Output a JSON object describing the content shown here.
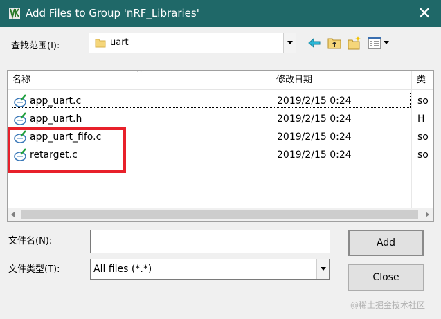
{
  "window": {
    "title": "Add Files to Group 'nRF_Libraries'",
    "close_glyph": "✕"
  },
  "toolbar": {
    "look_in_label": "查找范围(I):",
    "look_in_value": "uart",
    "buttons": [
      {
        "name": "back-icon"
      },
      {
        "name": "up-folder-icon"
      },
      {
        "name": "new-folder-icon"
      },
      {
        "name": "view-menu-icon"
      }
    ]
  },
  "file_list": {
    "columns": [
      "名称",
      "修改日期",
      "类"
    ],
    "sort_indicator": "^",
    "rows": [
      {
        "name": "app_uart.c",
        "date": "2019/2/15 0:24",
        "type": "so"
      },
      {
        "name": "app_uart.h",
        "date": "2019/2/15 0:24",
        "type": "H"
      },
      {
        "name": "app_uart_fifo.c",
        "date": "2019/2/15 0:24",
        "type": "so"
      },
      {
        "name": "retarget.c",
        "date": "2019/2/15 0:24",
        "type": "so"
      }
    ]
  },
  "form": {
    "filename_label": "文件名(N):",
    "filename_value": "",
    "filetype_label": "文件类型(T):",
    "filetype_value": "All files (*.*)"
  },
  "buttons": {
    "add_label": "Add",
    "close_label": "Close"
  },
  "watermark": "@稀土掘金技术社区",
  "colors": {
    "titlebar": "#1f6868",
    "annotation": "#e8202a",
    "dialog_bg": "#f0f0f0"
  }
}
